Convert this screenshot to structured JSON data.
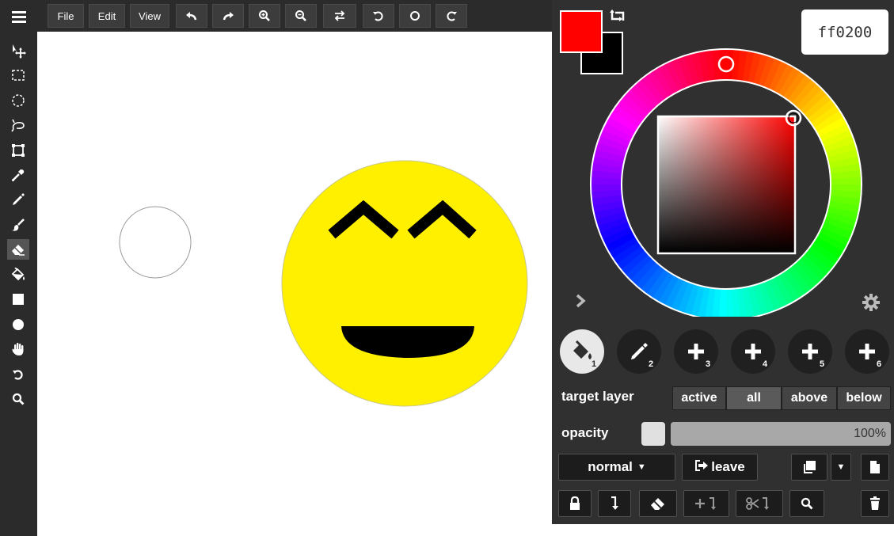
{
  "menubar": {
    "file_label": "File",
    "edit_label": "Edit",
    "view_label": "View"
  },
  "toolbar": {
    "tools": [
      "move-tool",
      "rect-select-tool",
      "ellipse-select-tool",
      "lasso-tool",
      "transform-tool",
      "eyedropper-tool",
      "pencil-tool",
      "brush-tool",
      "eraser-tool",
      "fill-tool",
      "rectangle-tool",
      "ellipse-tool",
      "hand-tool",
      "undo-tool",
      "zoom-tool"
    ],
    "active_tool": "eraser-tool"
  },
  "colors": {
    "primary": "#ff0200",
    "secondary": "#000000",
    "hex_value": "ff0200",
    "smiley_face": "#fff000"
  },
  "layers": {
    "slots": [
      {
        "num": "1",
        "icon": "fill-icon"
      },
      {
        "num": "2",
        "icon": "pencil-icon"
      },
      {
        "num": "3",
        "icon": "plus-icon"
      },
      {
        "num": "4",
        "icon": "plus-icon"
      },
      {
        "num": "5",
        "icon": "plus-icon"
      },
      {
        "num": "6",
        "icon": "plus-icon"
      }
    ]
  },
  "target_layer": {
    "label": "target layer",
    "options": [
      "active",
      "all",
      "above",
      "below"
    ],
    "selected": "all"
  },
  "opacity": {
    "label": "opacity",
    "value_text": "100%",
    "value": 1.0
  },
  "blend": {
    "mode_label": "normal",
    "leave_label": "leave"
  }
}
